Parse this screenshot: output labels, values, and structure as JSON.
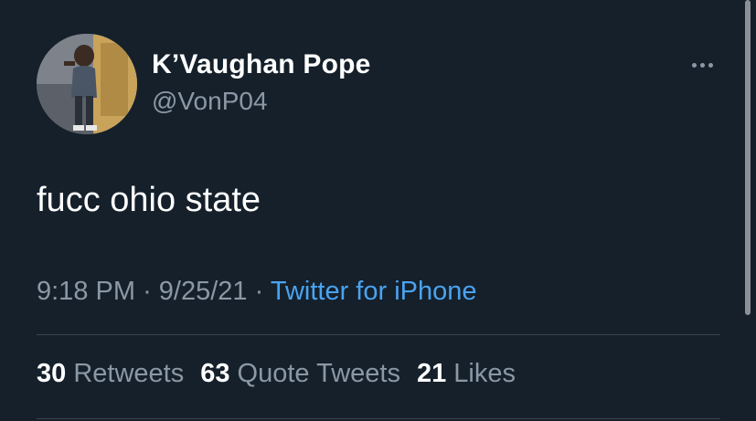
{
  "author": {
    "display_name": "K’Vaughan Pope",
    "handle": "@VonP04",
    "avatar": "profile-photo"
  },
  "tweet": {
    "text": "fucc ohio state",
    "time": "9:18 PM",
    "separator": "·",
    "date": "9/25/21",
    "source": "Twitter for iPhone"
  },
  "stats": {
    "retweets_count": "30",
    "retweets_label": "Retweets",
    "quote_tweets_count": "63",
    "quote_tweets_label": "Quote Tweets",
    "likes_count": "21",
    "likes_label": "Likes"
  },
  "icons": {
    "more": "more-dots-icon"
  },
  "colors": {
    "background": "#15202b",
    "primary_text": "#ffffff",
    "secondary_text": "#8b98a5",
    "link": "#4aa3f0",
    "divider": "#38444d"
  }
}
